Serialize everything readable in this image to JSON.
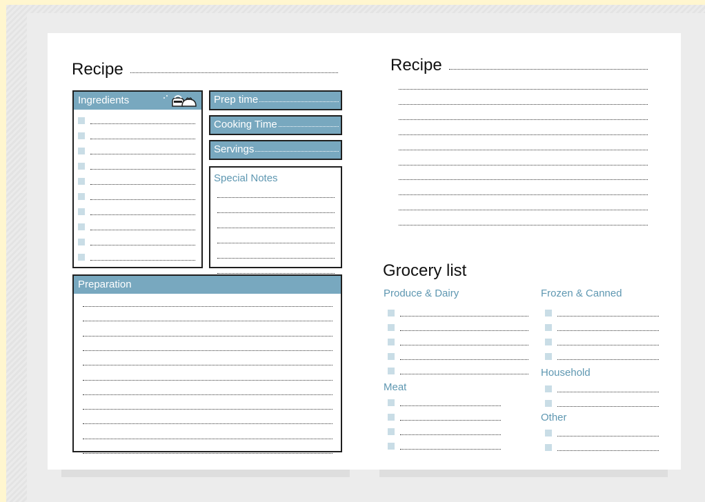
{
  "left_page": {
    "title": "Recipe",
    "ingredients": {
      "label": "Ingredients",
      "icon": "cooking-pot-icon",
      "rows": 10
    },
    "prep_time": {
      "label": "Prep time"
    },
    "cooking_time": {
      "label": "Cooking Time"
    },
    "servings": {
      "label": "Servings"
    },
    "special_notes": {
      "label": "Special Notes",
      "rows": 6
    },
    "preparation": {
      "label": "Preparation",
      "rows": 11
    }
  },
  "right_page": {
    "title": "Recipe",
    "lines": 10,
    "grocery": {
      "title": "Grocery list",
      "produce_dairy": {
        "label": "Produce & Dairy",
        "rows": 5
      },
      "meat": {
        "label": "Meat",
        "rows": 4
      },
      "frozen_canned": {
        "label": "Frozen & Canned",
        "rows": 4
      },
      "household": {
        "label": "Household",
        "rows": 2
      },
      "other": {
        "label": "Other",
        "rows": 2
      }
    }
  },
  "colors": {
    "accent_blue": "#78a8bf",
    "label_blue": "#5e97b1",
    "checkbox": "#c9dde6",
    "border": "#1e1e1e",
    "page_bg": "#fff6cf"
  }
}
